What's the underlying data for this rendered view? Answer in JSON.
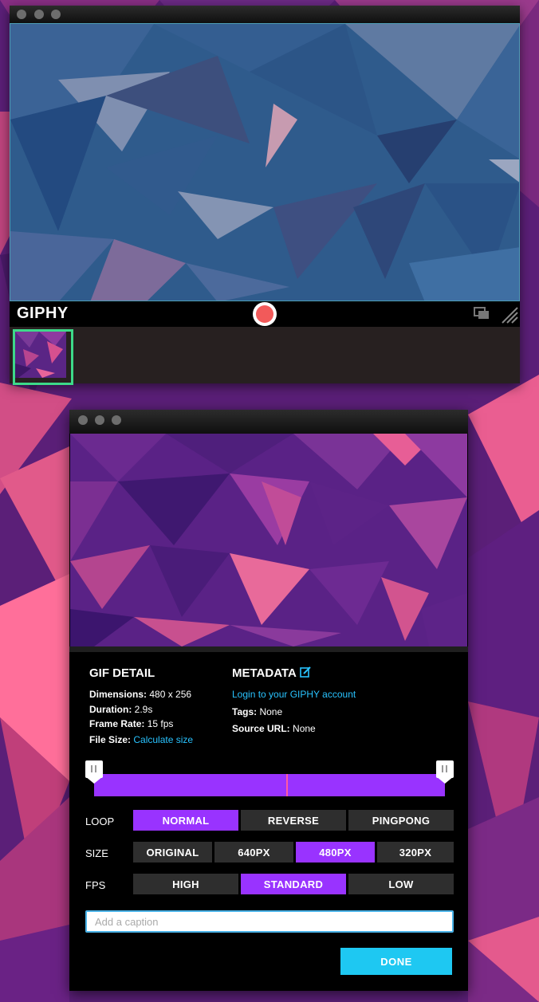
{
  "colors": {
    "accent_purple": "#9933ff",
    "link_blue": "#29c3ff",
    "done_blue": "#1ec8f2",
    "record_red": "#f25a5a",
    "thumb_border_green": "#3dd989"
  },
  "capture_window": {
    "logo": "GIPHY",
    "icons": [
      "record-button",
      "frames-icon",
      "resize-grip-icon"
    ]
  },
  "editor_window": {
    "gif_detail": {
      "title": "GIF DETAIL",
      "dimensions_label": "Dimensions:",
      "dimensions_value": "480 x 256",
      "duration_label": "Duration:",
      "duration_value": "2.9s",
      "frame_rate_label": "Frame Rate:",
      "frame_rate_value": "15 fps",
      "file_size_label": "File Size:",
      "file_size_link": "Calculate size"
    },
    "metadata": {
      "title": "METADATA",
      "login_link": "Login to your GIPHY account",
      "tags_label": "Tags:",
      "tags_value": "None",
      "source_label": "Source URL:",
      "source_value": "None"
    },
    "loop": {
      "label": "LOOP",
      "options": [
        "NORMAL",
        "REVERSE",
        "PINGPONG"
      ],
      "selected": "NORMAL"
    },
    "size": {
      "label": "SIZE",
      "options": [
        "ORIGINAL",
        "640PX",
        "480PX",
        "320PX"
      ],
      "selected": "480PX"
    },
    "fps": {
      "label": "FPS",
      "options": [
        "HIGH",
        "STANDARD",
        "LOW"
      ],
      "selected": "STANDARD"
    },
    "caption": {
      "placeholder": "Add a caption",
      "value": ""
    },
    "done_label": "DONE"
  }
}
